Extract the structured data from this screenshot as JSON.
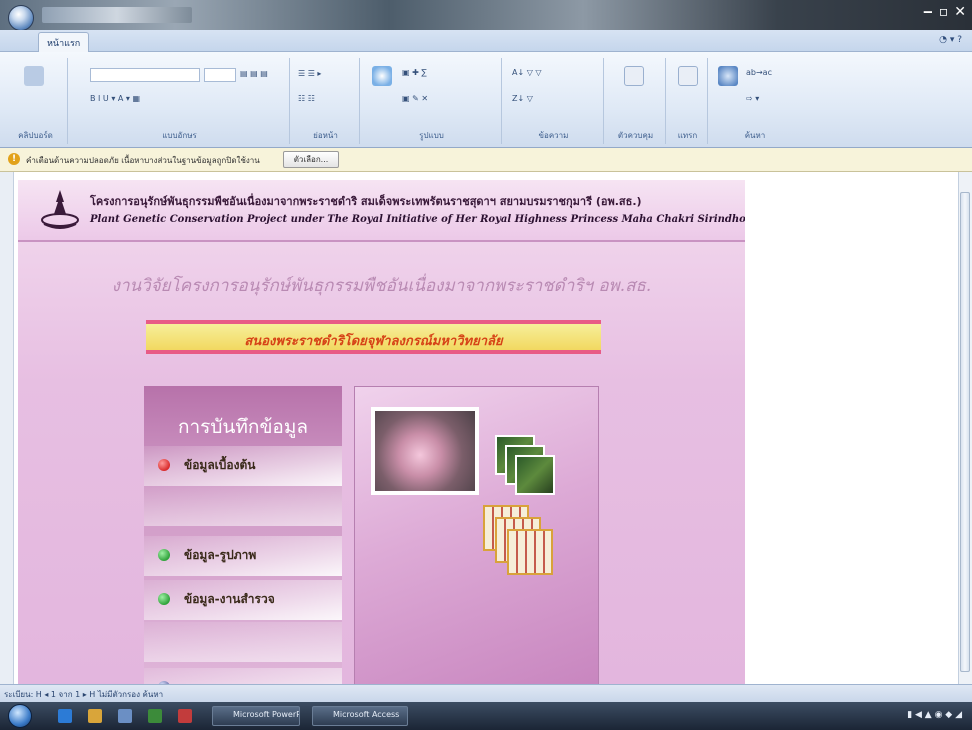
{
  "window": {
    "title": "",
    "tab_label": "หน้าแรก"
  },
  "ribbon": {
    "group_labels": [
      "คลิปบอร์ด",
      "แบบอักษร",
      "ย่อหน้า",
      "รูปแบบ",
      "ข้อความ",
      "ตัวควบคุม",
      "แทรก",
      "ค้นหา"
    ]
  },
  "message_bar": {
    "text": "คำเตือนด้านความปลอดภัย เนื้อหาบางส่วนในฐานข้อมูลถูกปิดใช้งาน",
    "button_label": "ตัวเลือก..."
  },
  "webpage": {
    "header_thai": "โครงการอนุรักษ์พันธุกรรมพืชอันเนื่องมาจากพระราชดำริ สมเด็จพระเทพรัตนราชสุดาฯ สยามบรมราชกุมารี (อพ.สธ.)",
    "header_english": "Plant Genetic Conservation Project under The Royal Initiative of Her Royal Highness Princess Maha Chakri Sirindhorn",
    "subtitle": "งานวิจัยโครงการอนุรักษ์พันธุกรรมพืชอันเนื่องมาจากพระราชดำริฯ อพ.สธ.",
    "banner": "สนองพระราชดำริโดยจุฬาลงกรณ์มหาวิทยาลัย",
    "menu_title": "การบันทึกข้อมูล",
    "menu_items": [
      {
        "label": "ข้อมูลเบื้องต้น",
        "dot_color": "#d92b2b"
      },
      {
        "label": "ข้อมูล-รูปภาพ",
        "dot_color": "#2fa23a"
      },
      {
        "label": "ข้อมูล-งานสำรวจ",
        "dot_color": "#2fa23a"
      }
    ]
  },
  "statusbar": {
    "text": "ระเบียน: H ◂ 1 จาก 1 ▸ H   ไม่มีตัวกรอง   ค้นหา"
  },
  "taskbar": {
    "tasks": [
      "Microsoft PowerPoint",
      "Microsoft Access"
    ],
    "tray_time": ""
  },
  "colors": {
    "page_bg": "#e7bfe2",
    "banner_border": "#e85b86",
    "banner_text": "#d64216",
    "menu_panel": "#b772aa"
  }
}
